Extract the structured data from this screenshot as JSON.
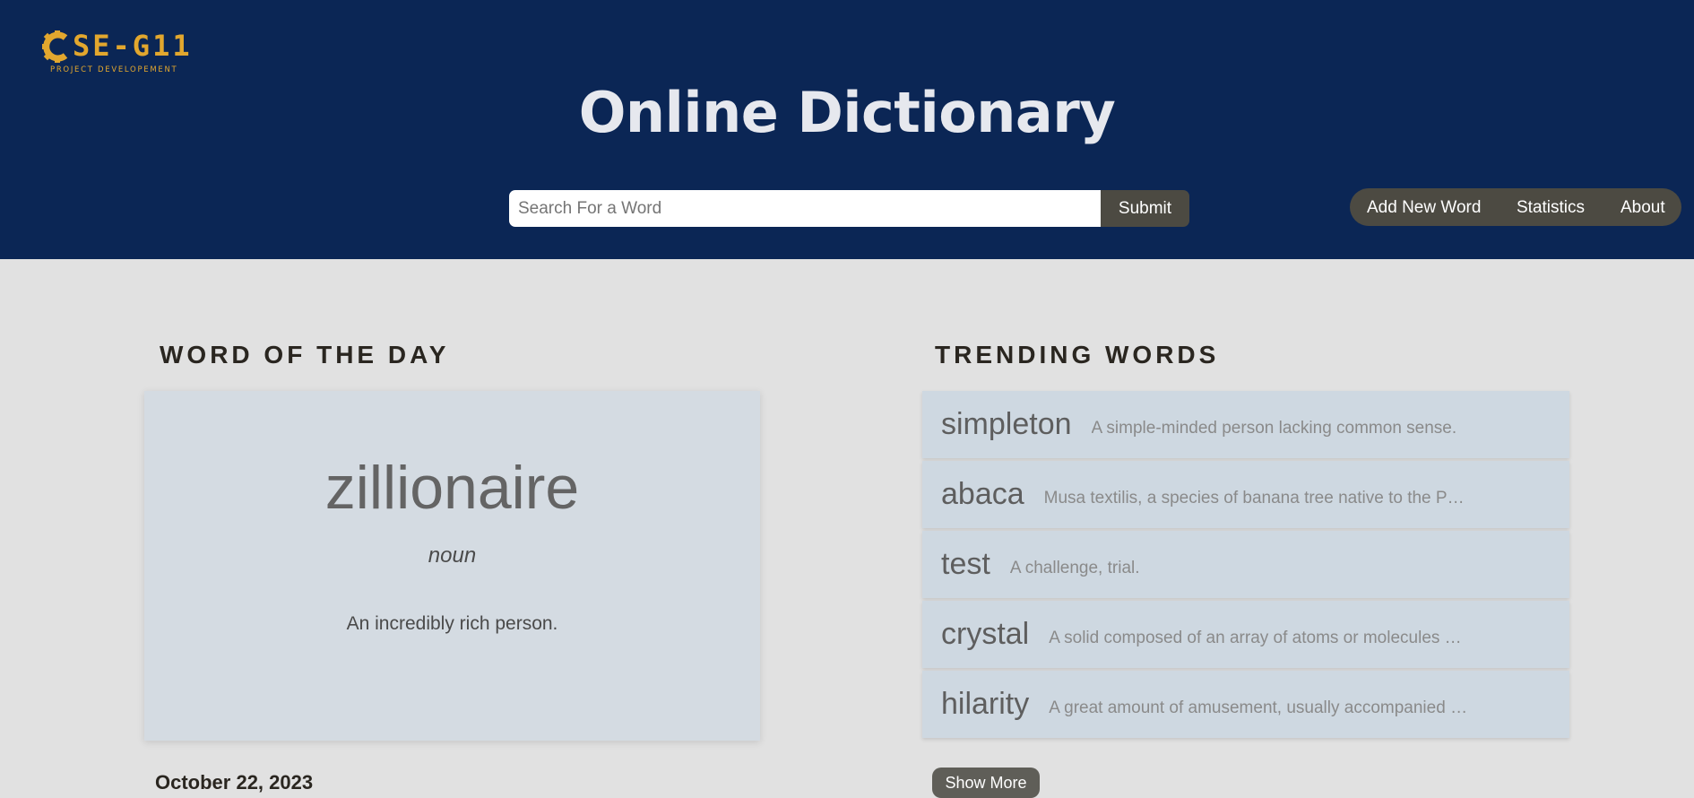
{
  "logo": {
    "title": "SE-G11",
    "subtitle": "PROJECT DEVELOPEMENT",
    "icon": "gear-c-icon",
    "color": "#e2a72e"
  },
  "header": {
    "title": "Online Dictionary",
    "background": "#0b2655"
  },
  "search": {
    "placeholder": "Search For a Word",
    "value": "",
    "submit_label": "Submit"
  },
  "nav": {
    "items": [
      {
        "label": "Add New Word"
      },
      {
        "label": "Statistics"
      },
      {
        "label": "About"
      }
    ]
  },
  "word_of_the_day": {
    "heading": "WORD OF THE DAY",
    "word": "zillionaire",
    "part_of_speech": "noun",
    "definition": "An incredibly rich person.",
    "date": "October 22, 2023"
  },
  "trending": {
    "heading": "TRENDING WORDS",
    "items": [
      {
        "word": "simpleton",
        "definition": "A simple-minded person lacking common sense."
      },
      {
        "word": "abaca",
        "definition": "Musa textilis, a species of banana tree native to the Philippines"
      },
      {
        "word": "test",
        "definition": "A challenge, trial."
      },
      {
        "word": "crystal",
        "definition": "A solid composed of an array of atoms or molecules possessing long-range order"
      },
      {
        "word": "hilarity",
        "definition": "A great amount of amusement, usually accompanied by laughter"
      }
    ],
    "show_more_label": "Show More"
  }
}
